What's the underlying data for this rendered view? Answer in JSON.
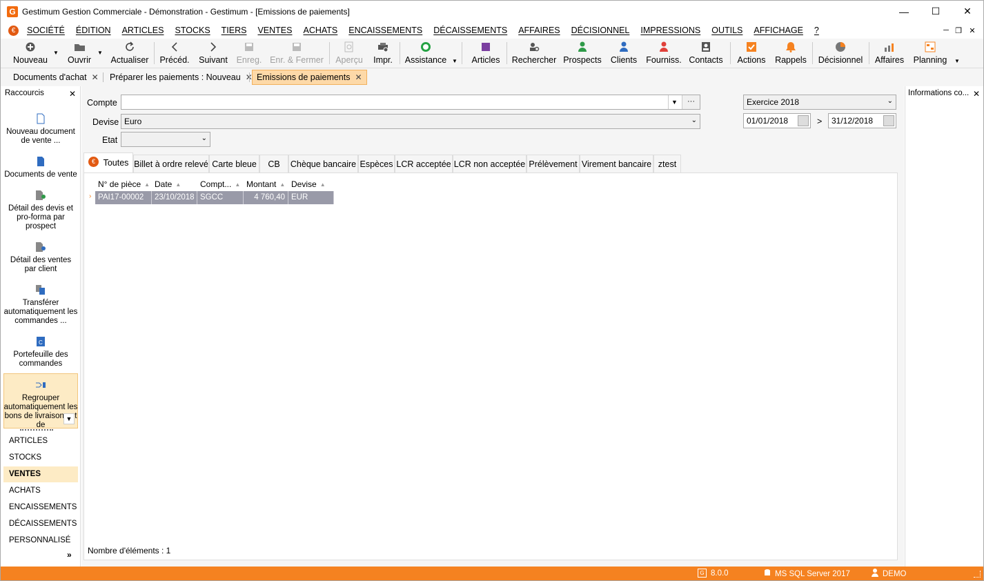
{
  "window": {
    "title": "Gestimum Gestion Commerciale - Démonstration - Gestimum - [Emissions de paiements]",
    "app_icon": "G"
  },
  "menu": {
    "logo": "€",
    "items": [
      "SOCIÉTÉ",
      "ÉDITION",
      "ARTICLES",
      "STOCKS",
      "TIERS",
      "VENTES",
      "ACHATS",
      "ENCAISSEMENTS",
      "DÉCAISSEMENTS",
      "AFFAIRES",
      "DÉCISIONNEL",
      "IMPRESSIONS",
      "OUTILS",
      "AFFICHAGE",
      "?"
    ]
  },
  "toolbar": {
    "nouveau": "Nouveau",
    "ouvrir": "Ouvrir",
    "actualiser": "Actualiser",
    "preced": "Précéd.",
    "suivant": "Suivant",
    "enreg": "Enreg.",
    "enr_fermer": "Enr. & Fermer",
    "apercu": "Aperçu",
    "impr": "Impr.",
    "assistance": "Assistance",
    "articles": "Articles",
    "rechercher": "Rechercher",
    "prospects": "Prospects",
    "clients": "Clients",
    "fourniss": "Fourniss.",
    "contacts": "Contacts",
    "actions": "Actions",
    "rappels": "Rappels",
    "decisionnel": "Décisionnel",
    "affaires": "Affaires",
    "planning": "Planning"
  },
  "doc_tabs": [
    "Documents d'achat",
    "Préparer les paiements : Nouveau",
    "Emissions de paiements"
  ],
  "shortcuts": {
    "title": "Raccourcis",
    "items": [
      "Nouveau document de vente ...",
      "Documents de vente",
      "Détail des devis et pro-forma par prospect",
      "Détail des ventes par client",
      "Transférer automatiquement les commandes ...",
      "Portefeuille des commandes",
      "Regrouper automatiquement les bons de livraisons et de"
    ],
    "categories": [
      "ARTICLES",
      "STOCKS",
      "VENTES",
      "ACHATS",
      "ENCAISSEMENTS",
      "DÉCAISSEMENTS",
      "PERSONNALISÉ"
    ],
    "more": "»"
  },
  "form": {
    "compte_label": "Compte",
    "compte_value": "",
    "compte_more": "···",
    "devise_label": "Devise",
    "devise_value": "Euro",
    "etat_label": "Etat",
    "etat_value": "",
    "exercice": "Exercice 2018",
    "date_from": "01/01/2018",
    "date_sep": ">",
    "date_to": "31/12/2018"
  },
  "type_tabs": [
    "Toutes",
    "Billet à ordre relevé",
    "Carte bleue",
    "CB",
    "Chèque bancaire",
    "Espèces",
    "LCR acceptée",
    "LCR non acceptée",
    "Prélèvement",
    "Virement bancaire",
    "ztest"
  ],
  "grid": {
    "columns": [
      "N° de pièce",
      "Date",
      "Compt...",
      "Montant",
      "Devise"
    ],
    "rows": [
      [
        "PAI17-00002",
        "23/10/2018",
        "SGCC",
        "4 760,40",
        "EUR"
      ]
    ],
    "count_label": "Nombre d'éléments : 1"
  },
  "info_panel": {
    "title": "Informations co..."
  },
  "status": {
    "version": "8.0.0",
    "db": "MS SQL Server 2017",
    "user": "DEMO"
  },
  "colors": {
    "accent": "#f58220",
    "active_tab": "#fdd9a8",
    "selected_row": "#999aa8"
  }
}
